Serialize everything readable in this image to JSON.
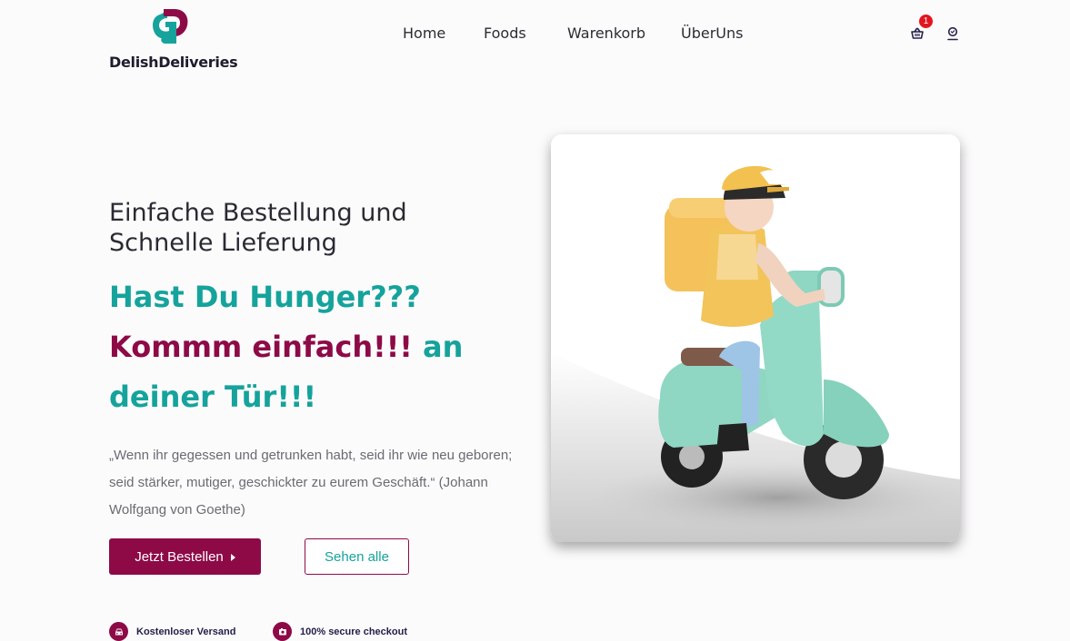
{
  "brand": {
    "name": "DelishDeliveries",
    "primary_color": "#8d0a47",
    "accent_color": "#15a39c"
  },
  "nav": {
    "items": [
      {
        "label": "Home"
      },
      {
        "label": "Foods"
      },
      {
        "label": "Warenkorb"
      },
      {
        "label": "ÜberUns"
      }
    ]
  },
  "header_actions": {
    "cart_icon": "basket-icon",
    "cart_count": "1",
    "user_icon": "user-icon"
  },
  "hero": {
    "subtitle_line1": "Einfache Bestellung und",
    "subtitle_line2": "Schnelle Lieferung",
    "title_part1": "Hast Du Hunger???",
    "title_part2": "Kommm einfach!!!",
    "title_part3": "an",
    "title_part4": "deiner Tür!!!",
    "quote": "„Wenn ihr gegessen und getrunken habt, seid ihr wie neu geboren; seid stärker, mutiger, geschickter zu eurem Geschäft.“ (Johann Wolfgang von Goethe)",
    "primary_button": "Jetzt Bestellen",
    "secondary_button": "Sehen alle",
    "image_alt": "delivery-rider-on-scooter"
  },
  "features": [
    {
      "icon": "car-icon",
      "label": "Kostenloser Versand"
    },
    {
      "icon": "secure-lock-icon",
      "label": "100% secure checkout"
    }
  ]
}
